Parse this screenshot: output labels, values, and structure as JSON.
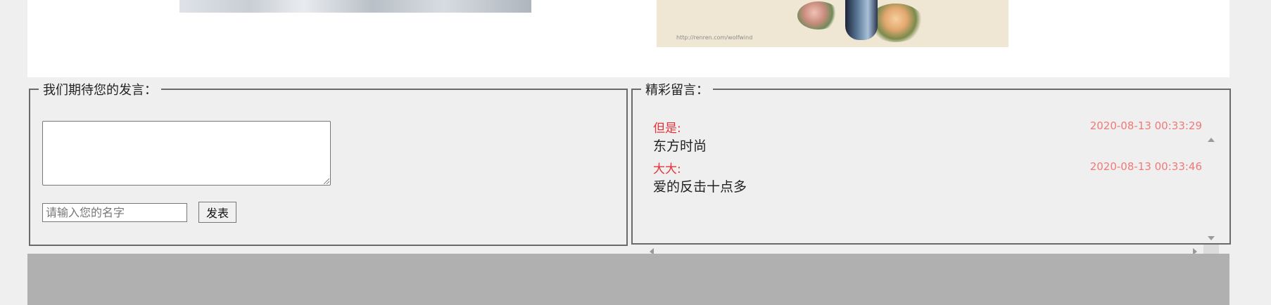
{
  "watermark": "http://renren.com/wolfwind",
  "post_form": {
    "legend": "我们期待您的发言：",
    "message_value": "",
    "name_placeholder": "请输入您的名字",
    "submit_label": "发表"
  },
  "comments_panel": {
    "legend": "精彩留言：",
    "items": [
      {
        "author": "但是:",
        "time": "2020-08-13 00:33:29",
        "text": "东方时尚"
      },
      {
        "author": "大大:",
        "time": "2020-08-13 00:33:46",
        "text": "爱的反击十点多"
      }
    ]
  },
  "colors": {
    "author": "#e8323a",
    "timestamp": "#f07a78",
    "footer": "#b0b0b0",
    "page_bg": "#efefef"
  }
}
